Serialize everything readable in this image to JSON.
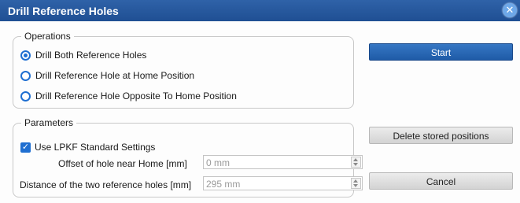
{
  "window": {
    "title": "Drill Reference Holes",
    "close_glyph": "✕",
    "close_icon": "close-icon"
  },
  "operations": {
    "legend": "Operations",
    "options": [
      {
        "label": "Drill Both Reference Holes",
        "selected": true
      },
      {
        "label": "Drill Reference Hole at Home Position",
        "selected": false
      },
      {
        "label": "Drill Reference Hole Opposite To Home Position",
        "selected": false
      }
    ]
  },
  "parameters": {
    "legend": "Parameters",
    "use_standard": {
      "label": "Use LPKF Standard Settings",
      "checked": true,
      "glyph": "✓"
    },
    "offset": {
      "label": "Offset of hole near Home [mm]",
      "value": "0 mm"
    },
    "distance": {
      "label": "Distance of the two reference holes [mm]",
      "value": "295 mm"
    }
  },
  "actions": {
    "start": "Start",
    "delete": "Delete stored positions",
    "cancel": "Cancel"
  },
  "colors": {
    "titlebar": "#1f4f93",
    "accent": "#1f6fd1",
    "primary_button": "#2a6ab8"
  }
}
